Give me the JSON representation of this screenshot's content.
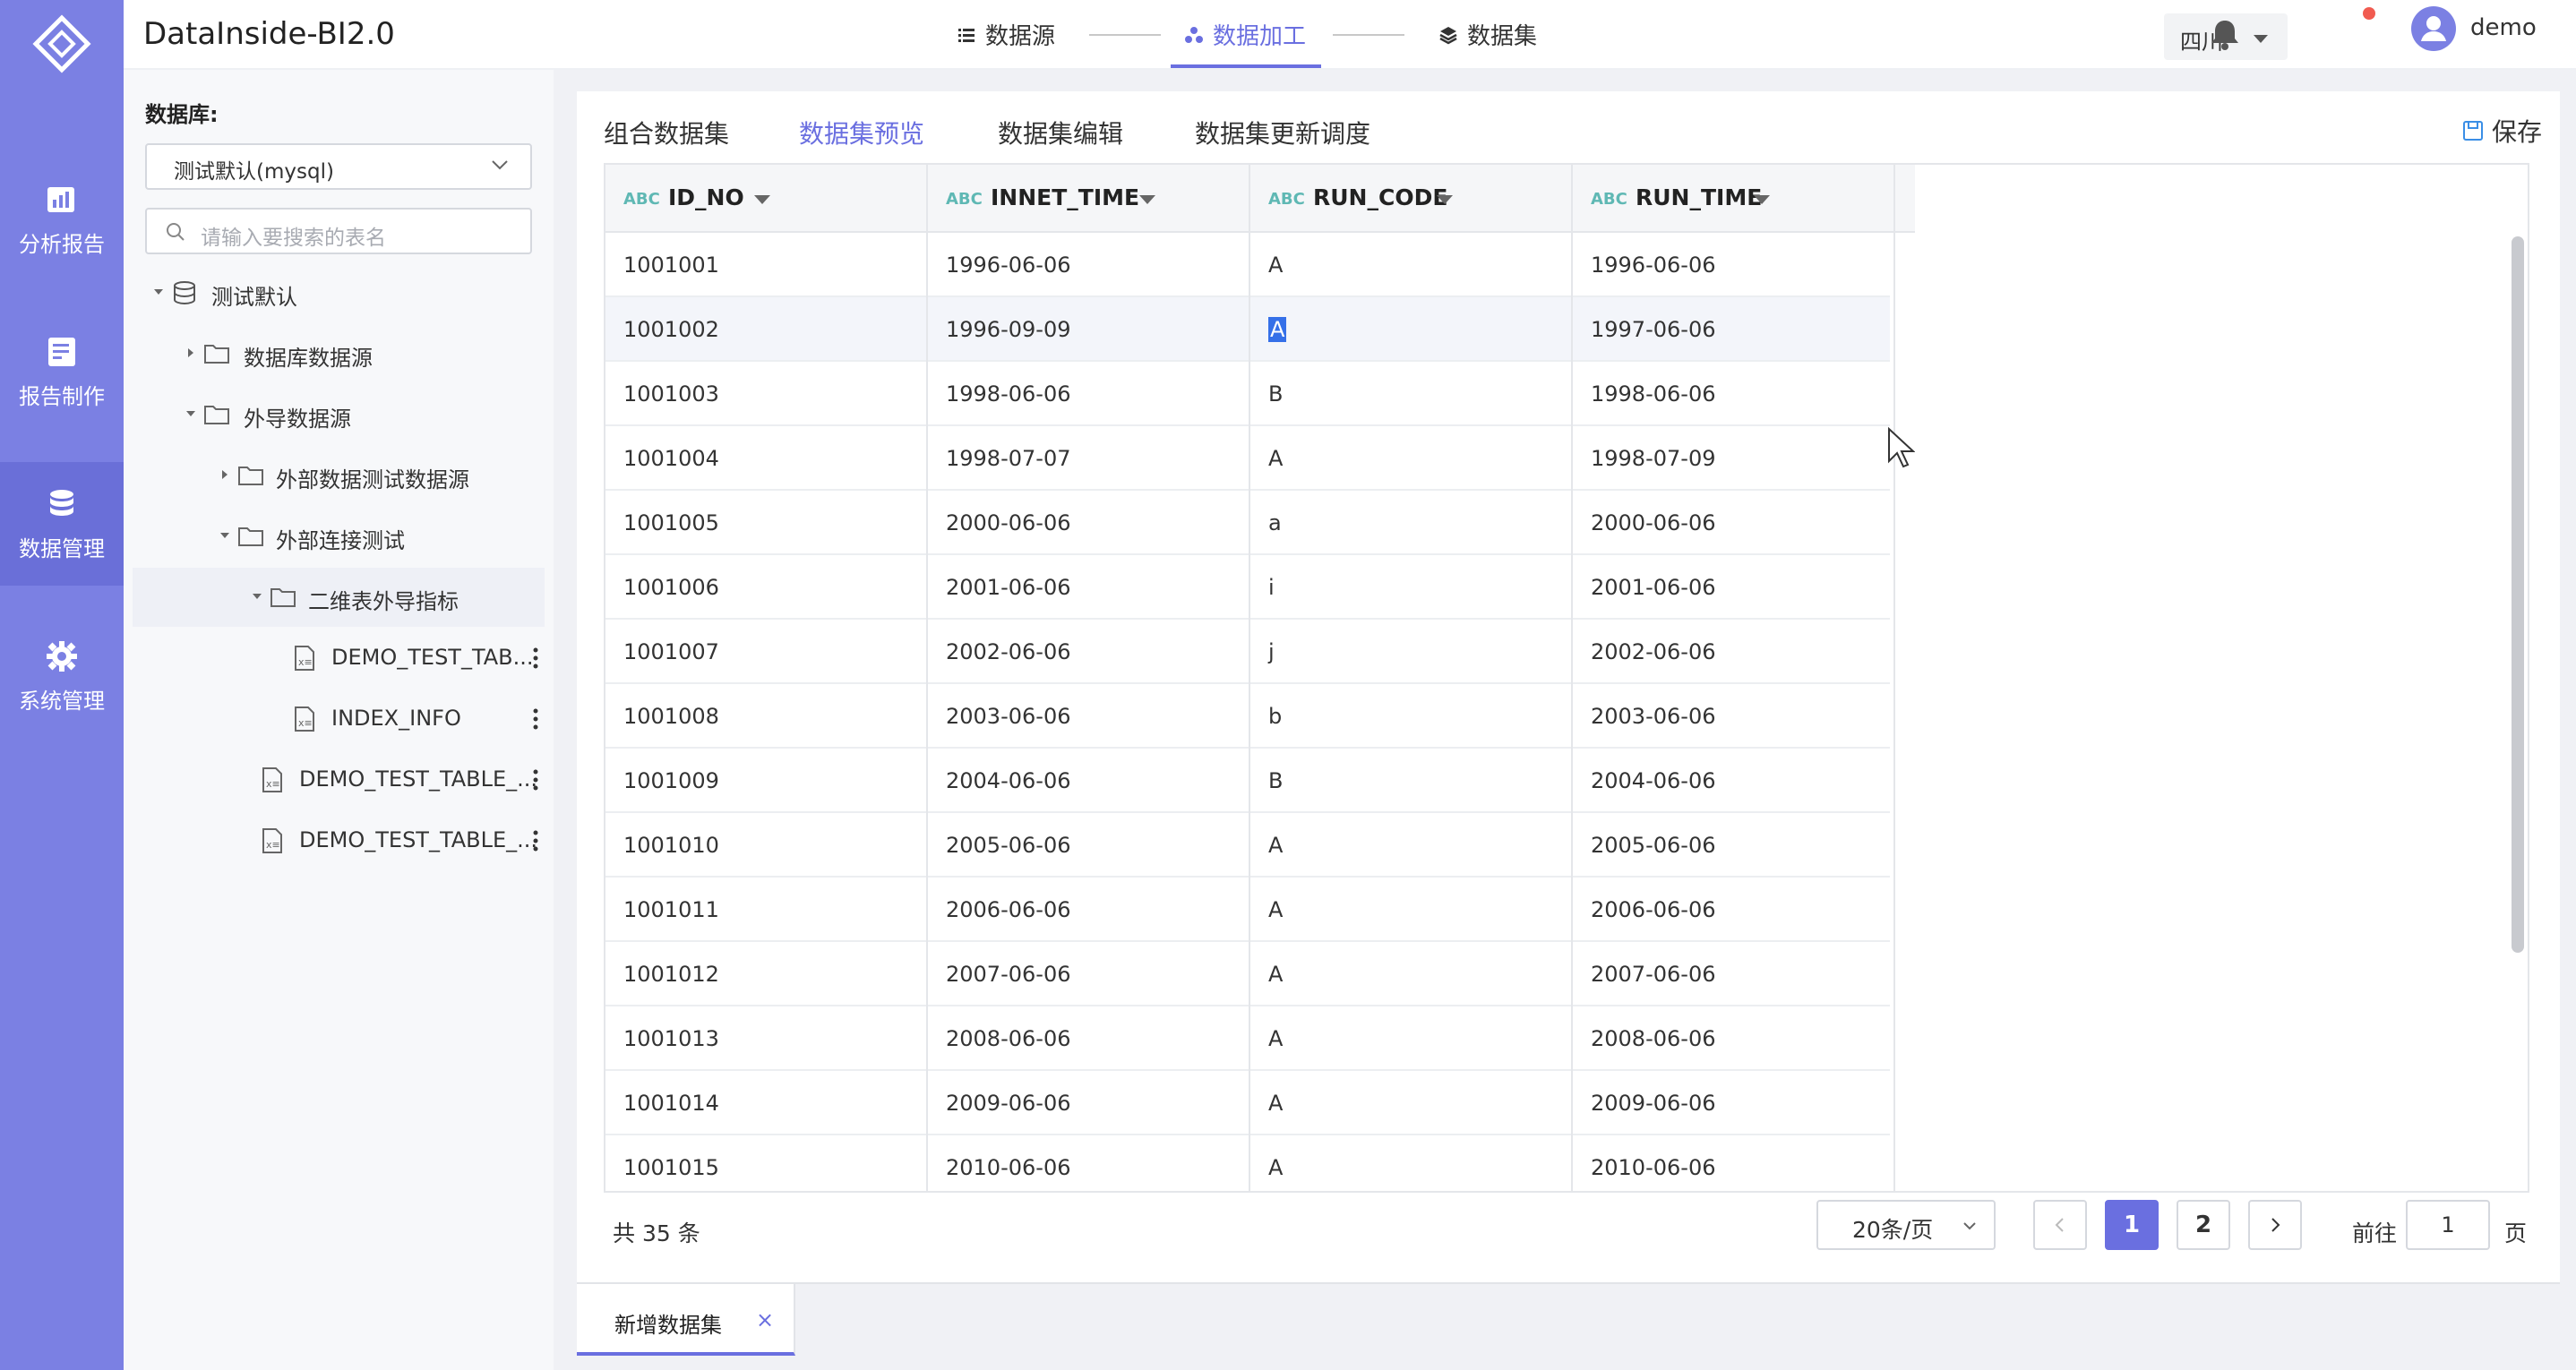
{
  "app": {
    "title": "DataInside-BI2.0"
  },
  "rail": {
    "items": [
      {
        "label": "分析报告",
        "icon": "analysis-report-icon"
      },
      {
        "label": "报告制作",
        "icon": "report-edit-icon"
      },
      {
        "label": "数据管理",
        "icon": "database-icon"
      },
      {
        "label": "系统管理",
        "icon": "gear-icon"
      }
    ],
    "active_index": 2
  },
  "steps": [
    {
      "label": "数据源",
      "icon": "list-icon"
    },
    {
      "label": "数据加工",
      "icon": "process-icon"
    },
    {
      "label": "数据集",
      "icon": "layers-icon"
    }
  ],
  "header": {
    "region": "四川",
    "username": "demo"
  },
  "sidebar": {
    "db_label": "数据库:",
    "db_selected": "测试默认(mysql)",
    "search_placeholder": "请输入要搜索的表名",
    "tree": [
      {
        "label": "测试默认",
        "type": "database",
        "expanded": true
      },
      {
        "label": "数据库数据源",
        "type": "folder",
        "expanded": false
      },
      {
        "label": "外导数据源",
        "type": "folder",
        "expanded": true
      },
      {
        "label": "外部数据测试数据源",
        "type": "folder",
        "expanded": false
      },
      {
        "label": "外部连接测试",
        "type": "folder",
        "expanded": true
      },
      {
        "label": "二维表外导指标",
        "type": "folder",
        "expanded": true,
        "selected": true
      },
      {
        "label": "DEMO_TEST_TAB...",
        "type": "table"
      },
      {
        "label": "INDEX_INFO",
        "type": "table"
      },
      {
        "label": "DEMO_TEST_TABLE_...",
        "type": "table"
      },
      {
        "label": "DEMO_TEST_TABLE_...",
        "type": "table"
      }
    ]
  },
  "tabs": [
    {
      "label": "组合数据集"
    },
    {
      "label": "数据集预览"
    },
    {
      "label": "数据集编辑"
    },
    {
      "label": "数据集更新调度"
    }
  ],
  "active_tab": 1,
  "save_label": "保存",
  "grid": {
    "type_badge": "ABC",
    "columns": [
      "ID_NO",
      "INNET_TIME",
      "RUN_CODE",
      "RUN_TIME"
    ],
    "rows": [
      [
        "1001001",
        "1996-06-06",
        "A",
        "1996-06-06"
      ],
      [
        "1001002",
        "1996-09-09",
        "A",
        "1997-06-06"
      ],
      [
        "1001003",
        "1998-06-06",
        "B",
        "1998-06-06"
      ],
      [
        "1001004",
        "1998-07-07",
        "A",
        "1998-07-09"
      ],
      [
        "1001005",
        "2000-06-06",
        "a",
        "2000-06-06"
      ],
      [
        "1001006",
        "2001-06-06",
        "i",
        "2001-06-06"
      ],
      [
        "1001007",
        "2002-06-06",
        "j",
        "2002-06-06"
      ],
      [
        "1001008",
        "2003-06-06",
        "b",
        "2003-06-06"
      ],
      [
        "1001009",
        "2004-06-06",
        "B",
        "2004-06-06"
      ],
      [
        "1001010",
        "2005-06-06",
        "A",
        "2005-06-06"
      ],
      [
        "1001011",
        "2006-06-06",
        "A",
        "2006-06-06"
      ],
      [
        "1001012",
        "2007-06-06",
        "A",
        "2007-06-06"
      ],
      [
        "1001013",
        "2008-06-06",
        "A",
        "2008-06-06"
      ],
      [
        "1001014",
        "2009-06-06",
        "A",
        "2009-06-06"
      ],
      [
        "1001015",
        "2010-06-06",
        "A",
        "2010-06-06"
      ]
    ],
    "highlighted_row": 1
  },
  "pagination": {
    "total": "共 35 条",
    "page_size": "20条/页",
    "pages": [
      "1",
      "2"
    ],
    "current_page": "1",
    "goto_label": "前往",
    "goto_value": "1",
    "goto_suffix": "页"
  },
  "bottom_tab": {
    "label": "新增数据集",
    "close": "×"
  },
  "colors": {
    "rail": "#7b80e3",
    "accent": "#6a6fe0",
    "selection": "#3570e8"
  }
}
